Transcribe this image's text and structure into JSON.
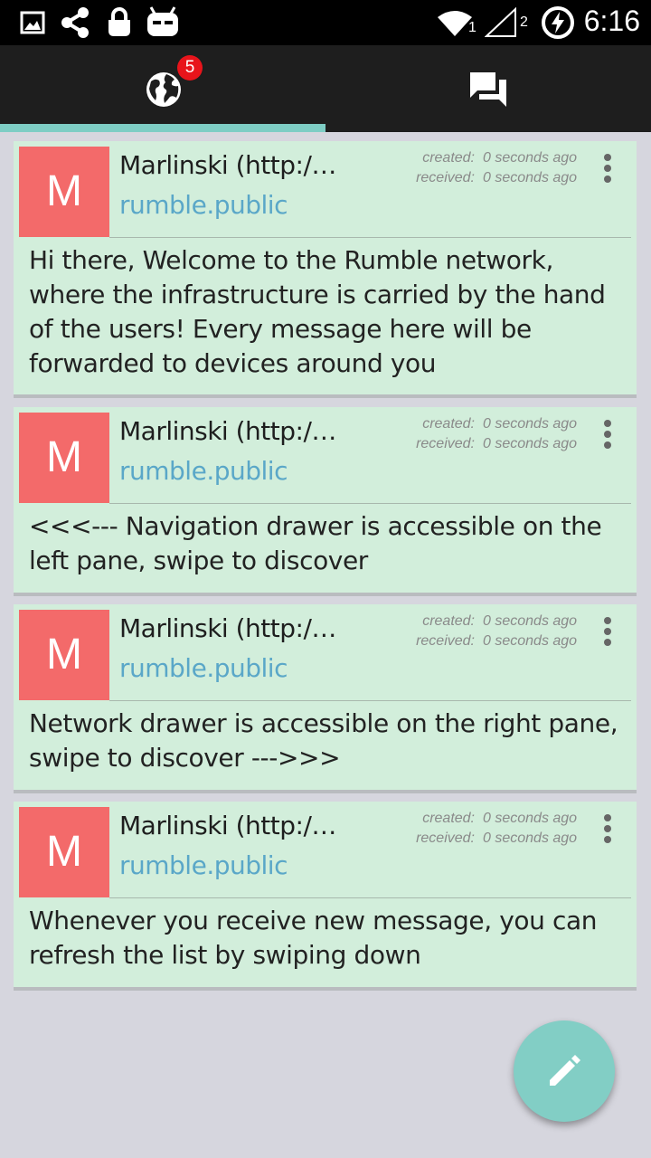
{
  "status_bar": {
    "time": "6:16",
    "sim1_label": "1",
    "sim2_label": "2",
    "icons": [
      "image-icon",
      "share-icon",
      "lock-icon",
      "cyanogen-icon",
      "wifi-icon",
      "signal-icon",
      "battery-charging-icon"
    ]
  },
  "tabs": {
    "public_badge": "5",
    "items": [
      {
        "icon": "globe-icon",
        "selected": true
      },
      {
        "icon": "chat-icon",
        "selected": false
      }
    ]
  },
  "labels": {
    "created": "created:",
    "received": "received:"
  },
  "messages": [
    {
      "avatar_letter": "M",
      "author": "Marlinski (http:/…",
      "group": "rumble.public",
      "created": "0 seconds ago",
      "received": "0 seconds ago",
      "body": "Hi there, Welcome to the Rumble network, where the infrastructure is carried by the hand of the users! Every message here will be forwarded to devices around you"
    },
    {
      "avatar_letter": "M",
      "author": "Marlinski (http:/…",
      "group": "rumble.public",
      "created": "0 seconds ago",
      "received": "0 seconds ago",
      "body": "<<<--- Navigation drawer is accessible on the left pane, swipe to discover"
    },
    {
      "avatar_letter": "M",
      "author": "Marlinski (http:/…",
      "group": "rumble.public",
      "created": "0 seconds ago",
      "received": "0 seconds ago",
      "body": "Network drawer is accessible on the right pane, swipe to discover --->>>"
    },
    {
      "avatar_letter": "M",
      "author": "Marlinski (http:/…",
      "group": "rumble.public",
      "created": "0 seconds ago",
      "received": "0 seconds ago",
      "body": "Whenever you receive new message, you can refresh the list by swiping down"
    }
  ],
  "colors": {
    "card_bg": "#d2eedb",
    "avatar_bg": "#f36a6a",
    "group_text": "#5aa7c8",
    "accent": "#7ecdc4",
    "badge": "#e8141b"
  },
  "fab": {
    "icon": "pencil-icon"
  }
}
